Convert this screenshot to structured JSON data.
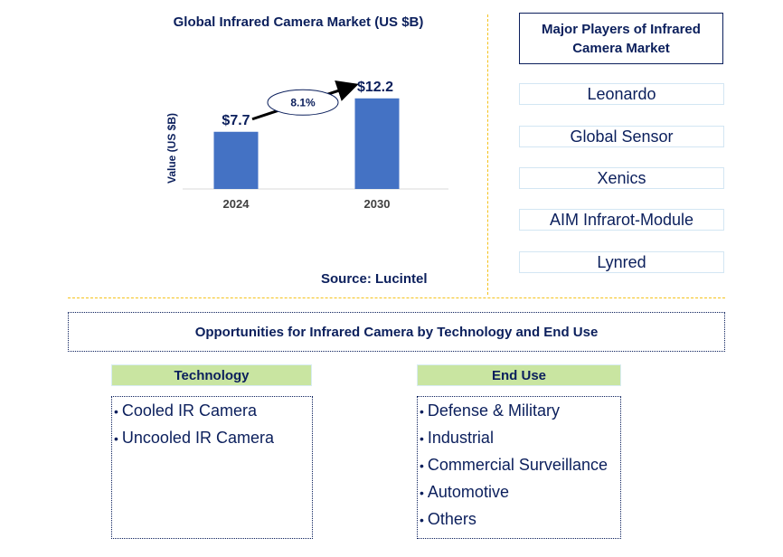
{
  "chart_data": {
    "type": "bar",
    "title": "Global Infrared Camera Market (US $B)",
    "xlabel": "",
    "ylabel": "Value (US $B)",
    "categories": [
      "2024",
      "2030"
    ],
    "values": [
      7.7,
      12.2
    ],
    "data_labels": [
      "$7.7",
      "$12.2"
    ],
    "ylim": [
      0,
      14
    ],
    "grid": false,
    "annotation": {
      "type": "cagr-arrow",
      "label": "8.1%"
    },
    "bar_color": "#4472c4",
    "source": "Source: Lucintel"
  },
  "players": {
    "title": "Major Players of Infrared Camera Market",
    "items": [
      "Leonardo",
      "Global Sensor",
      "Xenics",
      "AIM Infrarot-Module",
      "Lynred"
    ]
  },
  "opportunities": {
    "title": "Opportunities for Infrared Camera by Technology and End Use",
    "technology": {
      "heading": "Technology",
      "items": [
        "Cooled IR Camera",
        "Uncooled IR Camera"
      ]
    },
    "end_use": {
      "heading": "End Use",
      "items": [
        "Defense & Military",
        "Industrial",
        "Commercial Surveillance",
        "Automotive",
        "Others"
      ]
    }
  },
  "colors": {
    "navy": "#0b1f5c",
    "bar": "#4472c4",
    "divider": "#f5c21b",
    "category_header": "#c9e5a1"
  }
}
